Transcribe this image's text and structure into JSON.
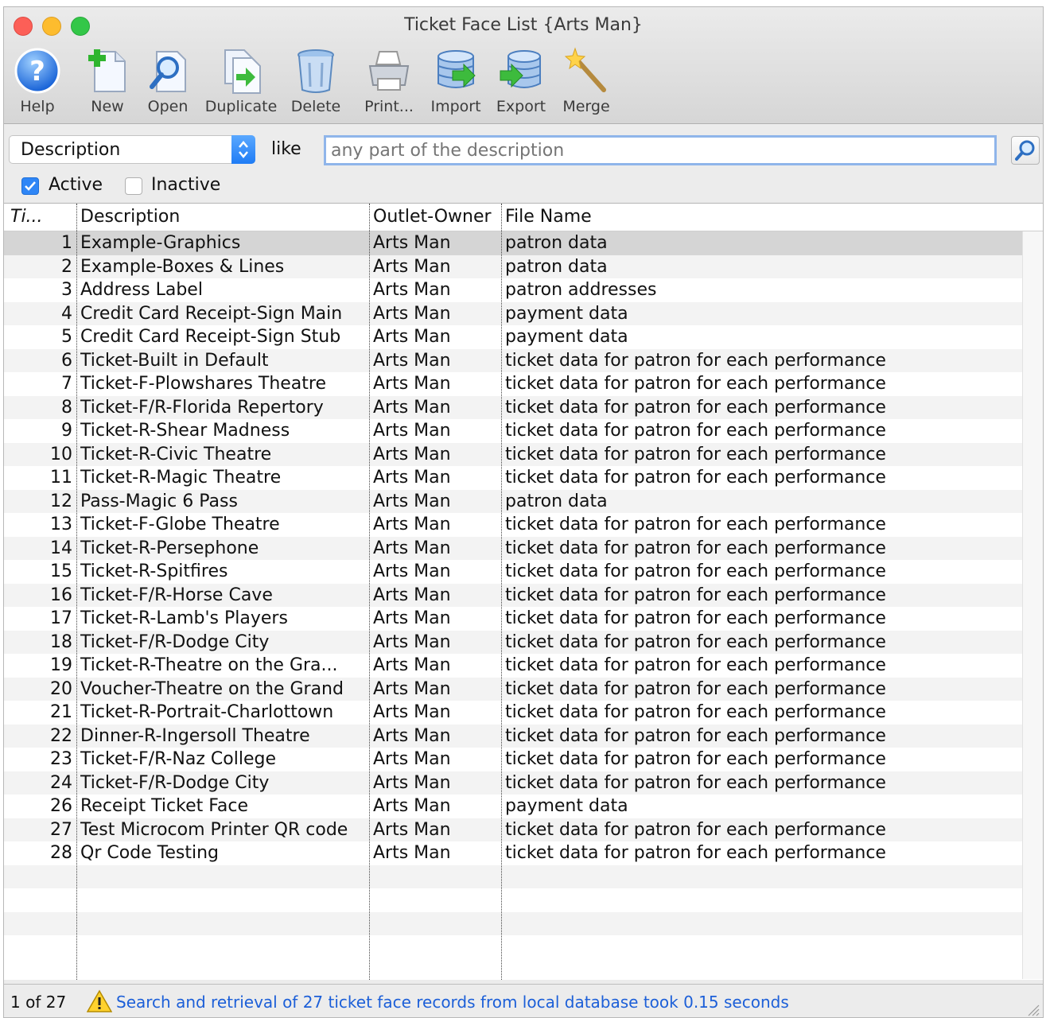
{
  "window": {
    "title": "Ticket Face List {Arts Man}"
  },
  "toolbar": [
    {
      "id": "help",
      "label": "Help",
      "icon": "help-icon"
    },
    {
      "id": "new",
      "label": "New",
      "icon": "new-document-icon"
    },
    {
      "id": "open",
      "label": "Open",
      "icon": "open-magnifier-icon"
    },
    {
      "id": "duplicate",
      "label": "Duplicate",
      "icon": "duplicate-icon"
    },
    {
      "id": "delete",
      "label": "Delete",
      "icon": "trash-icon"
    },
    {
      "id": "print",
      "label": "Print...",
      "icon": "printer-icon"
    },
    {
      "id": "import",
      "label": "Import",
      "icon": "database-import-icon"
    },
    {
      "id": "export",
      "label": "Export",
      "icon": "database-export-icon"
    },
    {
      "id": "merge",
      "label": "Merge",
      "icon": "magic-wand-icon"
    }
  ],
  "search": {
    "field": "Description",
    "operator": "like",
    "value": "",
    "placeholder": "any part of the description"
  },
  "filters": {
    "active": {
      "label": "Active",
      "checked": true
    },
    "inactive": {
      "label": "Inactive",
      "checked": false
    }
  },
  "table": {
    "headers": {
      "id": "Ti...",
      "description": "Description",
      "owner": "Outlet-Owner",
      "file": "File Name"
    },
    "rows": [
      {
        "id": "1",
        "description": "Example-Graphics",
        "owner": "Arts Man",
        "file": "patron data"
      },
      {
        "id": "2",
        "description": "Example-Boxes & Lines",
        "owner": "Arts Man",
        "file": "patron data"
      },
      {
        "id": "3",
        "description": "Address Label",
        "owner": "Arts Man",
        "file": "patron addresses"
      },
      {
        "id": "4",
        "description": "Credit Card Receipt-Sign Main",
        "owner": "Arts Man",
        "file": "payment data"
      },
      {
        "id": "5",
        "description": "Credit Card Receipt-Sign Stub",
        "owner": "Arts Man",
        "file": "payment data"
      },
      {
        "id": "6",
        "description": "Ticket-Built in Default",
        "owner": "Arts Man",
        "file": "ticket data for patron for each performance"
      },
      {
        "id": "7",
        "description": "Ticket-F-Plowshares Theatre",
        "owner": "Arts Man",
        "file": "ticket data for patron for each performance"
      },
      {
        "id": "8",
        "description": "Ticket-F/R-Florida Repertory",
        "owner": "Arts Man",
        "file": "ticket data for patron for each performance"
      },
      {
        "id": "9",
        "description": "Ticket-R-Shear Madness",
        "owner": "Arts Man",
        "file": "ticket data for patron for each performance"
      },
      {
        "id": "10",
        "description": "Ticket-R-Civic Theatre",
        "owner": "Arts Man",
        "file": "ticket data for patron for each performance"
      },
      {
        "id": "11",
        "description": "Ticket-R-Magic Theatre",
        "owner": "Arts Man",
        "file": "ticket data for patron for each performance"
      },
      {
        "id": "12",
        "description": "Pass-Magic 6 Pass",
        "owner": "Arts Man",
        "file": "patron data"
      },
      {
        "id": "13",
        "description": "Ticket-F-Globe Theatre",
        "owner": "Arts Man",
        "file": "ticket data for patron for each performance"
      },
      {
        "id": "14",
        "description": "Ticket-R-Persephone",
        "owner": "Arts Man",
        "file": "ticket data for patron for each performance"
      },
      {
        "id": "15",
        "description": "Ticket-R-Spitfires",
        "owner": "Arts Man",
        "file": "ticket data for patron for each performance"
      },
      {
        "id": "16",
        "description": "Ticket-F/R-Horse Cave",
        "owner": "Arts Man",
        "file": "ticket data for patron for each performance"
      },
      {
        "id": "17",
        "description": "Ticket-R-Lamb's Players",
        "owner": "Arts Man",
        "file": "ticket data for patron for each performance"
      },
      {
        "id": "18",
        "description": "Ticket-F/R-Dodge City",
        "owner": "Arts Man",
        "file": "ticket data for patron for each performance"
      },
      {
        "id": "19",
        "description": "Ticket-R-Theatre on the Gra...",
        "owner": "Arts Man",
        "file": "ticket data for patron for each performance"
      },
      {
        "id": "20",
        "description": "Voucher-Theatre on the Grand",
        "owner": "Arts Man",
        "file": "ticket data for patron for each performance"
      },
      {
        "id": "21",
        "description": "Ticket-R-Portrait-Charlottown",
        "owner": "Arts Man",
        "file": "ticket data for patron for each performance"
      },
      {
        "id": "22",
        "description": "Dinner-R-Ingersoll Theatre",
        "owner": "Arts Man",
        "file": "ticket data for patron for each performance"
      },
      {
        "id": "23",
        "description": "Ticket-F/R-Naz College",
        "owner": "Arts Man",
        "file": "ticket data for patron for each performance"
      },
      {
        "id": "24",
        "description": "Ticket-F/R-Dodge City",
        "owner": "Arts Man",
        "file": "ticket data for patron for each performance"
      },
      {
        "id": "26",
        "description": "Receipt Ticket Face",
        "owner": "Arts Man",
        "file": "payment data"
      },
      {
        "id": "27",
        "description": "Test Microcom Printer QR code",
        "owner": "Arts Man",
        "file": "ticket data for patron for each performance"
      },
      {
        "id": "28",
        "description": "Qr Code Testing",
        "owner": "Arts Man",
        "file": "ticket data for patron for each performance"
      }
    ],
    "selected_row": 0
  },
  "status": {
    "count": "1 of 27",
    "message": "Search and retrieval of 27 ticket face records from local database took 0.15 seconds",
    "icon": "warning-icon"
  },
  "colors": {
    "accent": "#2f86f6",
    "status_text": "#1c5fd8",
    "selection": "#d5d5d5"
  }
}
